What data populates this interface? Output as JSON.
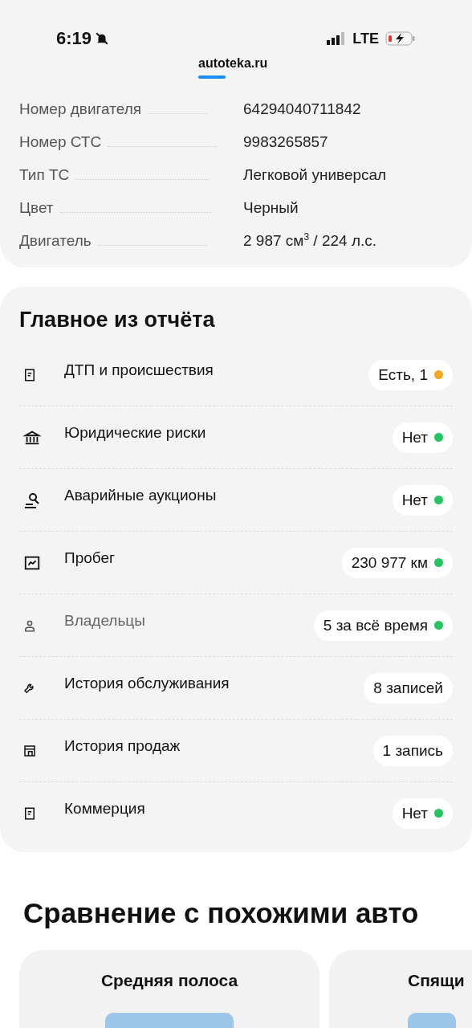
{
  "status_bar": {
    "time": "6:19",
    "network": "LTE"
  },
  "site": {
    "domain": "autoteka.ru"
  },
  "specs": [
    {
      "label": "Номер двигателя",
      "value": "64294040711842"
    },
    {
      "label": "Номер СТС",
      "value": "9983265857"
    },
    {
      "label": "Тип ТС",
      "value": "Легковой универсал"
    },
    {
      "label": "Цвет",
      "value": "Черный"
    },
    {
      "label": "Двигатель",
      "value": "2 987 см$^{3}$ / 224 л.с."
    }
  ],
  "summary": {
    "title": "Главное из отчёта",
    "items": [
      {
        "kind": "document",
        "label": "ДТП и происшествия",
        "badge": "Есть, 1",
        "color": "#f5a623",
        "muted": false
      },
      {
        "kind": "bank",
        "label": "Юридические риски",
        "badge": "Нет",
        "color": "#22c55e",
        "muted": false
      },
      {
        "kind": "gavel",
        "label": "Аварийные аукционы",
        "badge": "Нет",
        "color": "#22c55e",
        "muted": false
      },
      {
        "kind": "chart",
        "label": "Пробег",
        "badge": "230 977 км",
        "color": "#22c55e",
        "muted": false
      },
      {
        "kind": "person",
        "label": "Владельцы",
        "badge": "5 за всё время",
        "color": "#22c55e",
        "muted": true
      },
      {
        "kind": "wrench",
        "label": "История обслуживания",
        "badge": "8 записей",
        "muted": false
      },
      {
        "kind": "store",
        "label": "История продаж",
        "badge": "1 запись",
        "muted": false
      },
      {
        "kind": "document",
        "label": "Коммерция",
        "badge": "Нет",
        "color": "#22c55e",
        "muted": false
      }
    ]
  },
  "comparison": {
    "title": "Сравнение с похожими авто",
    "cards": [
      {
        "title": "Средняя полоса"
      },
      {
        "title": "Спящи"
      }
    ]
  }
}
